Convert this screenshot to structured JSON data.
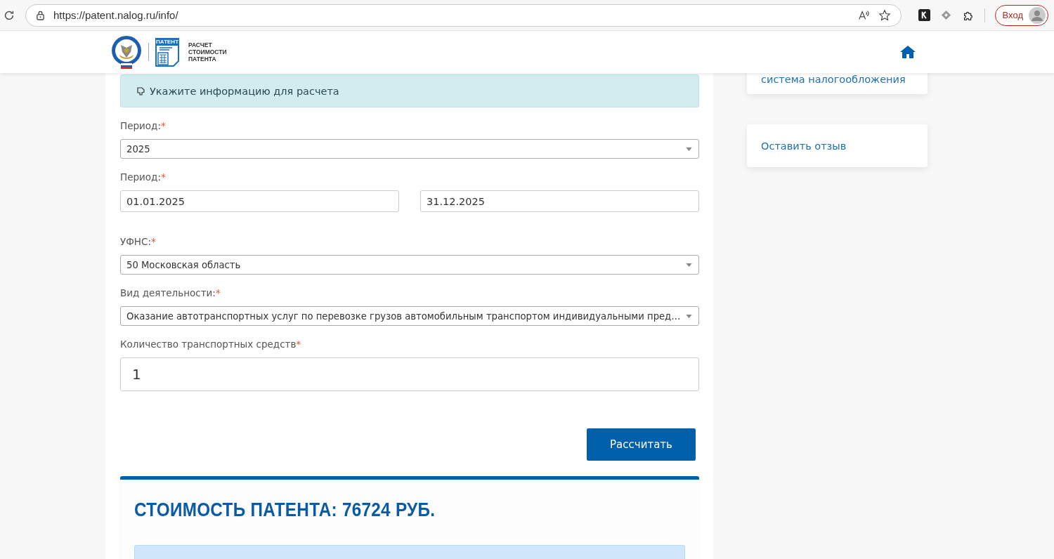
{
  "browser": {
    "url": "https://patent.nalog.ru/info/",
    "signin_label": "Вход"
  },
  "header": {
    "logo_badge": "ПАТЕНТ",
    "logo_lines": [
      "РАСЧЕТ",
      "СТОИМОСТИ",
      "ПАТЕНТА"
    ]
  },
  "info_banner": "Укажите информацию для расчета",
  "fields": [
    {
      "kind": "select",
      "label": "Период:",
      "required_mark": "*",
      "value": "2025"
    },
    {
      "kind": "date_range",
      "label": "Период:",
      "required_mark": "*",
      "values": [
        "01.01.2025",
        "31.12.2025"
      ]
    },
    {
      "kind": "select",
      "label": "УФНС:",
      "required_mark": "*",
      "value": "50 Московская область"
    },
    {
      "kind": "select",
      "label": "Вид деятельности:",
      "required_mark": "*",
      "value": "Оказание автотранспортных услуг по перевозке грузов автомобильным транспортом индивидуальными пред…"
    },
    {
      "kind": "number",
      "label": "Количество транспортных средств",
      "required_mark": "*",
      "value": "1"
    }
  ],
  "submit_button": "Рассчитать",
  "result": {
    "title": "СТОИМОСТЬ ПАТЕНТА: 76724 РУБ."
  },
  "sidebar": {
    "links": [
      "система налогообложения",
      "Оставить отзыв"
    ]
  }
}
